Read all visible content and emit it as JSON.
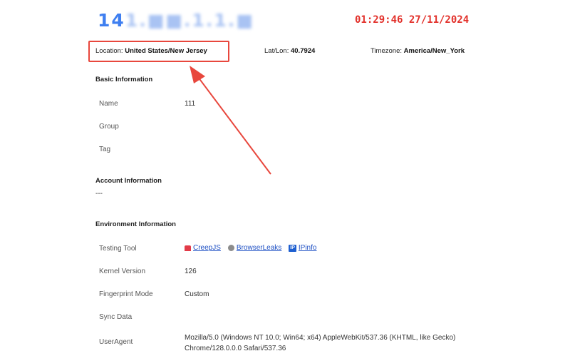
{
  "header": {
    "ip_visible": "14",
    "ip_masked": "1.■■.1.1.■",
    "datetime": "01:29:46 27/11/2024"
  },
  "location_row": {
    "location_label": "Location:",
    "location_value": "United States/New Jersey",
    "latlon_label": "Lat/Lon:",
    "latlon_value": "40.7924",
    "timezone_label": "Timezone:",
    "timezone_value": "America/New_York"
  },
  "basic": {
    "title": "Basic Information",
    "name_label": "Name",
    "name_value": "111",
    "group_label": "Group",
    "tag_label": "Tag"
  },
  "account": {
    "title": "Account Information",
    "value": "---"
  },
  "environment": {
    "title": "Environment Information",
    "testing_tool_label": "Testing Tool",
    "tools": [
      "CreepJS",
      "BrowserLeaks",
      "IPinfo"
    ],
    "ipinfo_badge": "IP",
    "kernel_label": "Kernel Version",
    "kernel_value": "126",
    "fingerprint_label": "Fingerprint Mode",
    "fingerprint_value": "Custom",
    "sync_label": "Sync Data",
    "ua_label": "UserAgent",
    "ua_line1": "Mozilla/5.0 (Windows NT 10.0; Win64; x64) AppleWebKit/537.36 (KHTML, like Gecko)",
    "ua_line2": "Chrome/128.0.0.0 Safari/537.36"
  },
  "colors": {
    "accent_blue": "#3f7ff0",
    "clock_red": "#e2302a",
    "highlight_red": "#e8473d",
    "link_blue": "#1d4fc4"
  }
}
